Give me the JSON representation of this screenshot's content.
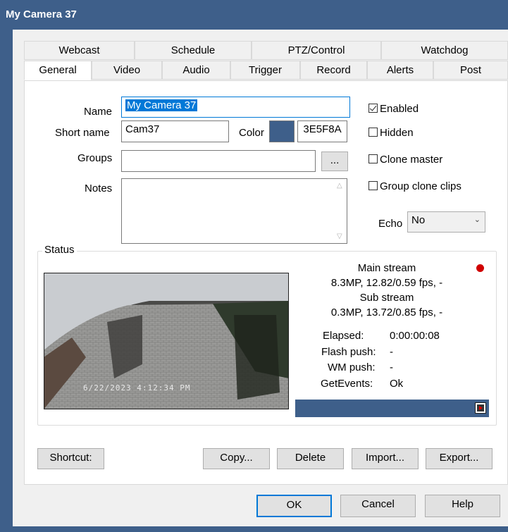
{
  "window": {
    "title": "My Camera 37"
  },
  "tabs": {
    "row1": [
      "Webcast",
      "Schedule",
      "PTZ/Control",
      "Watchdog"
    ],
    "row2": [
      "General",
      "Video",
      "Audio",
      "Trigger",
      "Record",
      "Alerts",
      "Post"
    ],
    "active": "General"
  },
  "form": {
    "name_label": "Name",
    "name_value": "My Camera 37",
    "short_name_label": "Short name",
    "short_name_value": "Cam37",
    "color_label": "Color",
    "color_hex": "3E5F8A",
    "color_swatch": "#3e5f8a",
    "groups_label": "Groups",
    "groups_value": "",
    "groups_button": "...",
    "notes_label": "Notes",
    "notes_value": ""
  },
  "options": {
    "enabled": {
      "label": "Enabled",
      "checked": true
    },
    "hidden": {
      "label": "Hidden",
      "checked": false
    },
    "clone_master": {
      "label": "Clone master",
      "checked": false
    },
    "group_clone_clips": {
      "label": "Group clone clips",
      "checked": false
    },
    "echo_label": "Echo",
    "echo_value": "No"
  },
  "status": {
    "label": "Status",
    "timestamp_overlay": "6/22/2023 4:12:34 PM",
    "main_stream_label": "Main stream",
    "main_stream_value": "8.3MP, 12.82/0.59 fps, -",
    "sub_stream_label": "Sub stream",
    "sub_stream_value": "0.3MP, 13.72/0.85 fps, -",
    "elapsed_label": "Elapsed:",
    "elapsed_value": "0:00:00:08",
    "flash_push_label": "Flash push:",
    "flash_push_value": "-",
    "wm_push_label": "WM push:",
    "wm_push_value": "-",
    "getevents_label": "GetEvents:",
    "getevents_value": "Ok",
    "indicator_color": "#d00000"
  },
  "actions": {
    "shortcut": "Shortcut:",
    "copy": "Copy...",
    "delete": "Delete",
    "import": "Import...",
    "export": "Export..."
  },
  "dialog": {
    "ok": "OK",
    "cancel": "Cancel",
    "help": "Help"
  }
}
